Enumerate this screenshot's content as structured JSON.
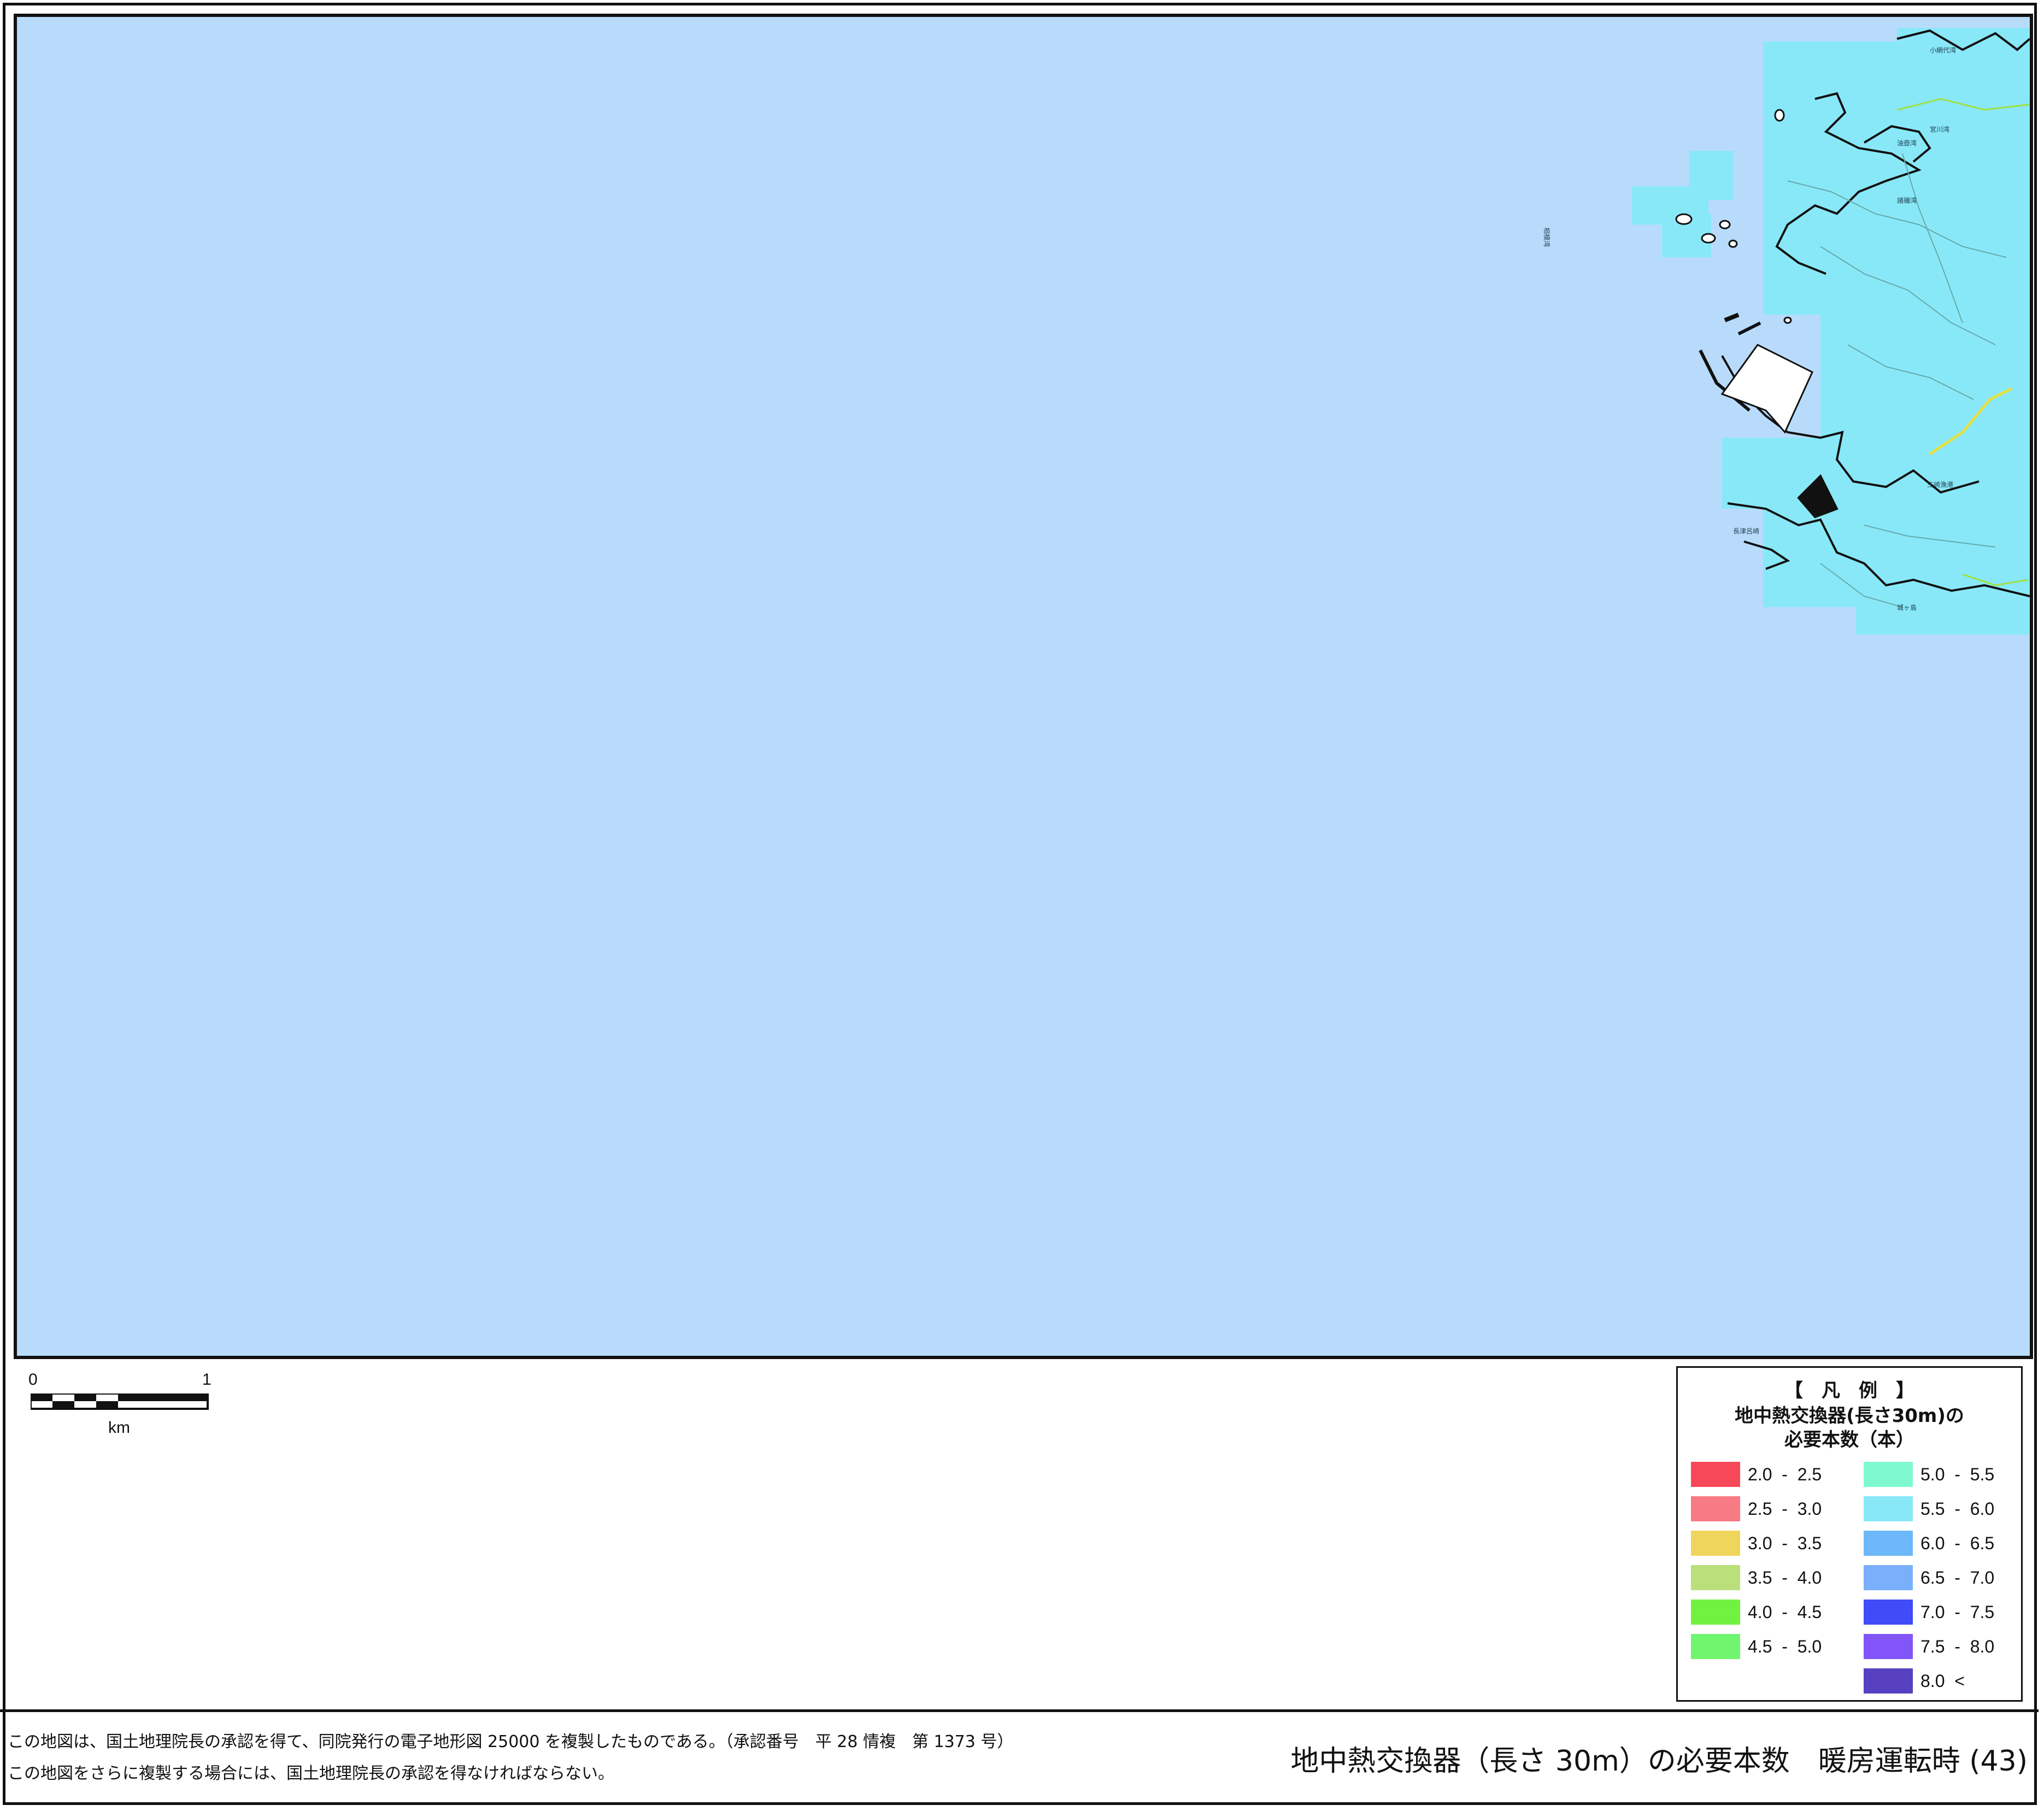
{
  "map": {
    "colors": {
      "sea": "#b8dbfc",
      "land_5_5_6_0": "#88e8f8",
      "roads": "#7ab",
      "coast": "#111",
      "contour": "#9fe040"
    },
    "place_labels": [
      "小網代湾",
      "城ヶ島",
      "三崎漁港",
      "長津呂崎",
      "油壺湾",
      "相模湾",
      "諸磯湾",
      "宮川湾"
    ]
  },
  "scale": {
    "zero": "0",
    "one": "1",
    "unit": "km"
  },
  "legend": {
    "heading": "【　凡　例　】",
    "subtitle_1": "地中熱交換器(長さ30m)の",
    "subtitle_2": "必要本数（本）",
    "items": [
      {
        "range": "2.0  -  2.5",
        "color": "#f7485a"
      },
      {
        "range": "2.5  -  3.0",
        "color": "#f77a84"
      },
      {
        "range": "3.0  -  3.5",
        "color": "#efd55c"
      },
      {
        "range": "3.5  -  4.0",
        "color": "#bbdf7a"
      },
      {
        "range": "4.0  -  4.5",
        "color": "#72f240"
      },
      {
        "range": "4.5  -  5.0",
        "color": "#70f56e"
      },
      {
        "range": "5.0  -  5.5",
        "color": "#7ff9cf"
      },
      {
        "range": "5.5  -  6.0",
        "color": "#88e8f8"
      },
      {
        "range": "6.0  -  6.5",
        "color": "#6cb8f8"
      },
      {
        "range": "6.5  -  7.0",
        "color": "#7ab0fb"
      },
      {
        "range": "7.0  -  7.5",
        "color": "#3f4cf8"
      },
      {
        "range": "7.5  -  8.0",
        "color": "#8255f8"
      },
      {
        "range": "8.0  <",
        "color": "#5741c0"
      }
    ]
  },
  "footer": {
    "credit_1": "この地図は、国土地理院長の承認を得て、同院発行の電子地形図 25000 を複製したものである。（承認番号　平 28 情複　第 1373 号）",
    "credit_2": "この地図をさらに複製する場合には、国土地理院長の承認を得なければならない。",
    "title": "地中熱交換器（長さ 30m）の必要本数　暖房運転時 (43)"
  }
}
